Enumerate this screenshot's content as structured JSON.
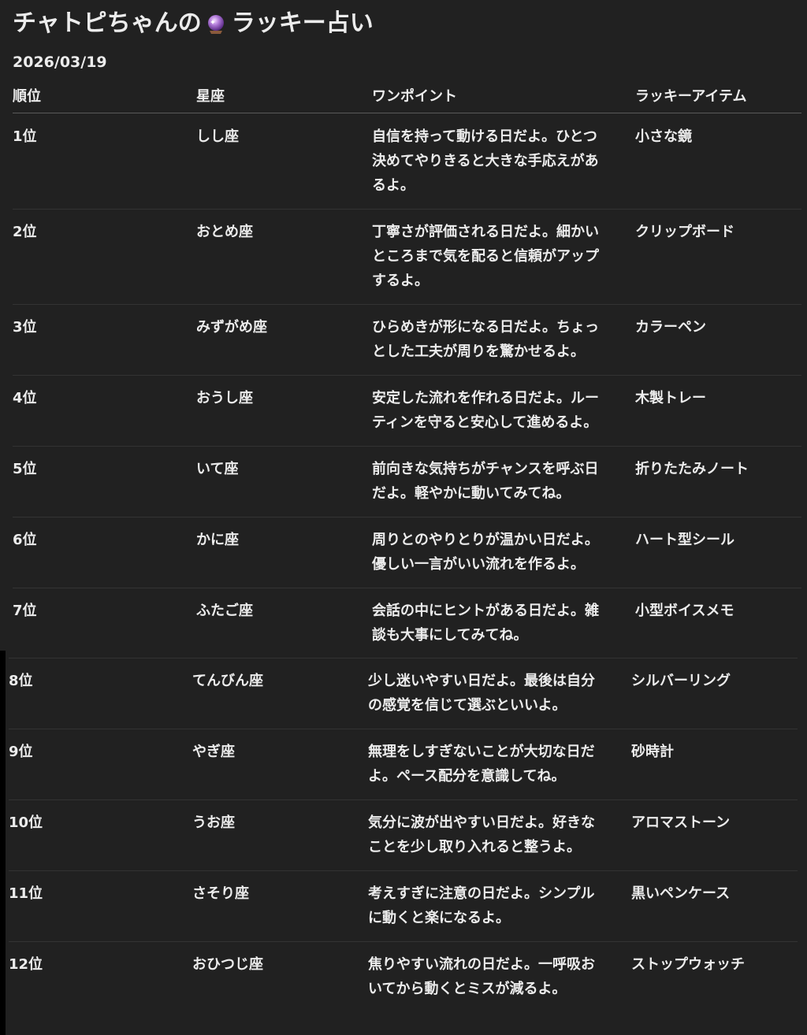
{
  "title": {
    "text": "チャトピちゃんの",
    "suffix": "ラッキー占い",
    "icon": "crystal-ball-icon"
  },
  "date": "2026/03/19",
  "table": {
    "headers": [
      "順位",
      "星座",
      "ワンポイント",
      "ラッキーアイテム"
    ],
    "rows": [
      {
        "rank": "1位",
        "sign": "しし座",
        "tip": "自信を持って動ける日だよ。ひとつ\n決めてやりきると大きな手応えがあ\nるよ。",
        "item": "小さな鏡"
      },
      {
        "rank": "2位",
        "sign": "おとめ座",
        "tip": "丁寧さが評価される日だよ。細かい\nところまで気を配ると信頼がアップ\nするよ。",
        "item": "クリップボード"
      },
      {
        "rank": "3位",
        "sign": "みずがめ座",
        "tip": "ひらめきが形になる日だよ。ちょっ\nとした工夫が周りを驚かせるよ。",
        "item": "カラーペン"
      },
      {
        "rank": "4位",
        "sign": "おうし座",
        "tip": "安定した流れを作れる日だよ。ルー\nティンを守ると安心して進めるよ。",
        "item": "木製トレー"
      },
      {
        "rank": "5位",
        "sign": "いて座",
        "tip": "前向きな気持ちがチャンスを呼ぶ日\nだよ。軽やかに動いてみてね。",
        "item": "折りたたみノート"
      },
      {
        "rank": "6位",
        "sign": "かに座",
        "tip": "周りとのやりとりが温かい日だよ。\n優しい一言がいい流れを作るよ。",
        "item": "ハート型シール"
      },
      {
        "rank": "7位",
        "sign": "ふたご座",
        "tip": "会話の中にヒントがある日だよ。雑\n談も大事にしてみてね。",
        "item": "小型ボイスメモ"
      },
      {
        "rank": "8位",
        "sign": "てんびん座",
        "tip": "少し迷いやすい日だよ。最後は自分\nの感覚を信じて選ぶといいよ。",
        "item": "シルバーリング"
      },
      {
        "rank": "9位",
        "sign": "やぎ座",
        "tip": "無理をしすぎないことが大切な日だ\nよ。ペース配分を意識してね。",
        "item": "砂時計"
      },
      {
        "rank": "10位",
        "sign": "うお座",
        "tip": "気分に波が出やすい日だよ。好きな\nことを少し取り入れると整うよ。",
        "item": "アロマストーン"
      },
      {
        "rank": "11位",
        "sign": "さそり座",
        "tip": "考えすぎに注意の日だよ。シンプル\nに動くと楽になるよ。",
        "item": "黒いペンケース"
      },
      {
        "rank": "12位",
        "sign": "おひつじ座",
        "tip": "焦りやすい流れの日だよ。一呼吸お\nいてから動くとミスが減るよ。",
        "item": "ストップウォッチ"
      }
    ]
  },
  "colors": {
    "background": "#212121",
    "text": "#ececec",
    "outer": "#000000"
  }
}
